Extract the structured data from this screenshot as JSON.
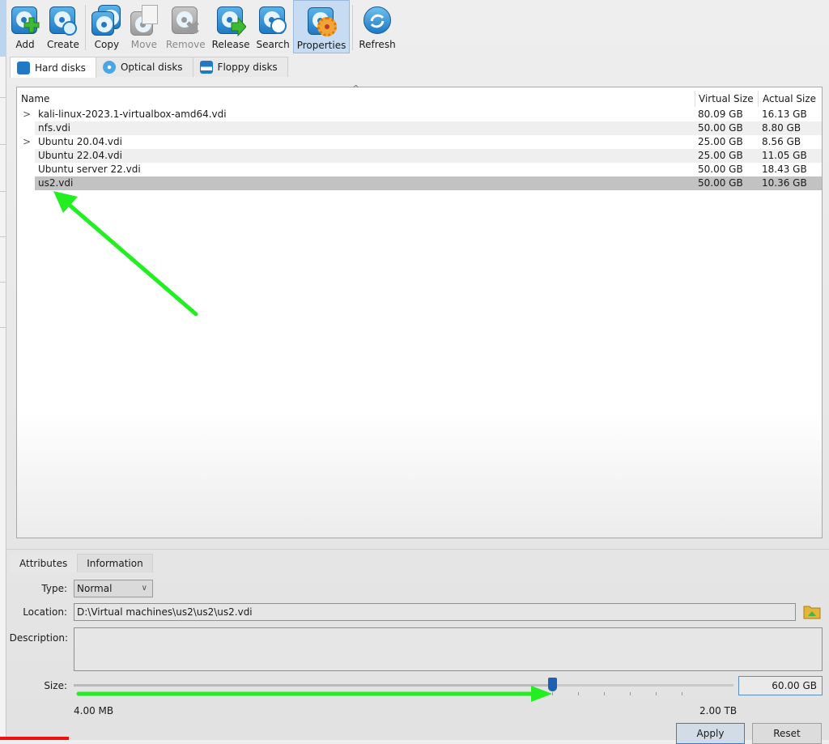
{
  "toolbar": {
    "buttons": [
      {
        "label": "Add",
        "icon": "add-disk-icon",
        "state": "enabled"
      },
      {
        "label": "Create",
        "icon": "create-disk-icon",
        "state": "enabled"
      },
      {
        "label": "Copy",
        "icon": "copy-disk-icon",
        "state": "enabled"
      },
      {
        "label": "Move",
        "icon": "move-disk-icon",
        "state": "disabled"
      },
      {
        "label": "Remove",
        "icon": "remove-disk-icon",
        "state": "disabled"
      },
      {
        "label": "Release",
        "icon": "release-disk-icon",
        "state": "enabled"
      },
      {
        "label": "Search",
        "icon": "search-disk-icon",
        "state": "enabled"
      },
      {
        "label": "Properties",
        "icon": "properties-gear-icon",
        "state": "active"
      },
      {
        "label": "Refresh",
        "icon": "refresh-icon",
        "state": "enabled"
      }
    ]
  },
  "media_tabs": [
    {
      "label": "Hard disks",
      "active": true
    },
    {
      "label": "Optical disks",
      "active": false
    },
    {
      "label": "Floppy disks",
      "active": false
    }
  ],
  "table": {
    "columns": [
      "Name",
      "Virtual Size",
      "Actual Size"
    ],
    "rows": [
      {
        "name": "kali-linux-2023.1-virtualbox-amd64.vdi",
        "virtual_size": "80.09 GB",
        "actual_size": "16.13 GB",
        "expandable": true,
        "selected": false
      },
      {
        "name": "nfs.vdi",
        "virtual_size": "50.00 GB",
        "actual_size": "8.80 GB",
        "expandable": false,
        "selected": false
      },
      {
        "name": "Ubuntu 20.04.vdi",
        "virtual_size": "25.00 GB",
        "actual_size": "8.56 GB",
        "expandable": true,
        "selected": false
      },
      {
        "name": "Ubuntu 22.04.vdi",
        "virtual_size": "25.00 GB",
        "actual_size": "11.05 GB",
        "expandable": false,
        "selected": false
      },
      {
        "name": "Ubuntu server 22.vdi",
        "virtual_size": "50.00 GB",
        "actual_size": "18.43 GB",
        "expandable": false,
        "selected": false
      },
      {
        "name": "us2.vdi",
        "virtual_size": "50.00 GB",
        "actual_size": "10.36 GB",
        "expandable": false,
        "selected": true
      }
    ]
  },
  "details": {
    "tabs": [
      {
        "label": "Attributes",
        "active": true
      },
      {
        "label": "Information",
        "active": false
      }
    ],
    "type_label": "Type:",
    "type_value": "Normal",
    "location_label": "Location:",
    "location_value": "D:\\Virtual machines\\us2\\us2\\us2.vdi",
    "description_label": "Description:",
    "description_value": "",
    "size_label": "Size:",
    "size_value": "60.00 GB",
    "size_min_label": "4.00 MB",
    "size_max_label": "2.00 TB",
    "size_slider_fraction": 0.725,
    "apply_label": "Apply",
    "reset_label": "Reset"
  },
  "annotation_color": "#22ee22"
}
